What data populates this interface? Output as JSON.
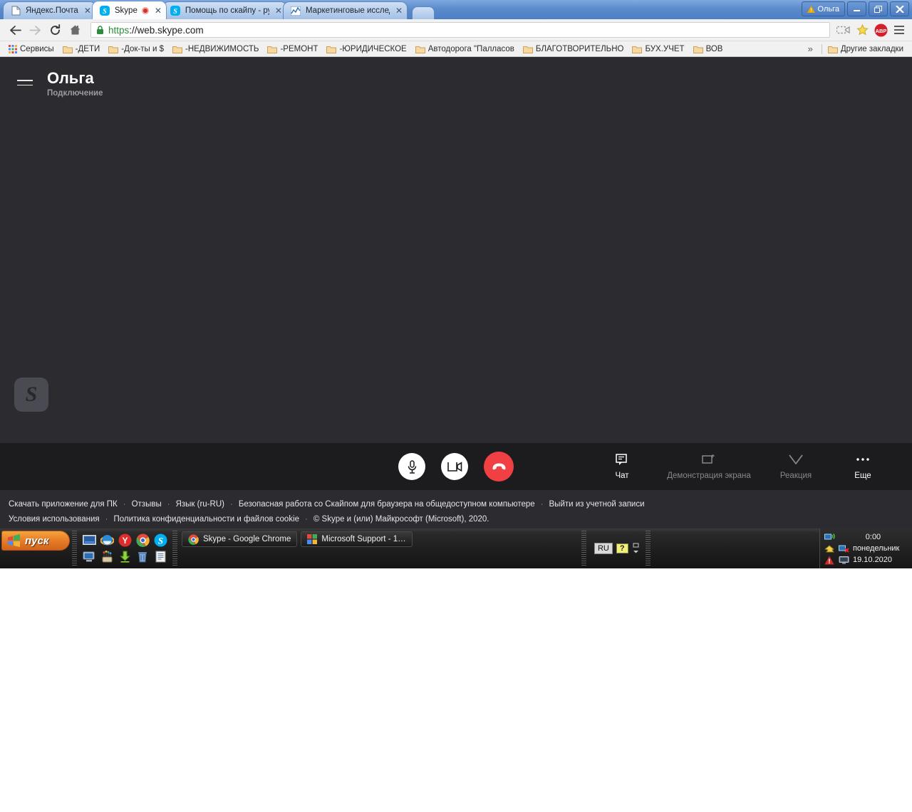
{
  "browser": {
    "tabs": [
      {
        "title": "Яндекс.Почта",
        "icon": "page-icon",
        "active": false,
        "recording": false
      },
      {
        "title": "Skype",
        "icon": "skype-icon",
        "active": true,
        "recording": true
      },
      {
        "title": "Помощь по скайпу - руков",
        "icon": "skype-icon",
        "active": false,
        "recording": false
      },
      {
        "title": "Маркетинговые исследова",
        "icon": "chart-icon",
        "active": false,
        "recording": false
      }
    ],
    "window": {
      "profile_label": "Ольга",
      "minimize": "—",
      "restore": "❐",
      "close": "✕"
    },
    "toolbar": {
      "back": "back-arrow",
      "forward": "forward-arrow",
      "reload": "reload-icon",
      "home": "home-icon",
      "url_scheme": "https",
      "url_rest": "://web.skype.com",
      "cast": "cast-icon",
      "bookmark_star": "star-icon",
      "extension": "ABP",
      "menu": "hamburger-menu"
    },
    "bookmarks": {
      "apps_label": "Сервисы",
      "items": [
        {
          "label": "-ДЕТИ"
        },
        {
          "label": "-Док-ты и $"
        },
        {
          "label": "-НЕДВИЖИМОСТЬ"
        },
        {
          "label": "-РЕМОНТ"
        },
        {
          "label": "-ЮРИДИЧЕСКОЕ"
        },
        {
          "label": "Автодорога \"Палласов"
        },
        {
          "label": "БЛАГОТВОРИТЕЛЬНО"
        },
        {
          "label": "БУХ.УЧЕТ"
        },
        {
          "label": "ВОВ"
        }
      ],
      "overflow": "»",
      "other_label": "Другие закладки"
    }
  },
  "skype": {
    "header": {
      "menu": "hamburger-menu",
      "name": "Ольга",
      "status": "Подключение"
    },
    "avatar_letter": "S",
    "call_controls": [
      {
        "name": "microphone",
        "style": "light"
      },
      {
        "name": "camera",
        "style": "light"
      },
      {
        "name": "end-call",
        "style": "hang"
      }
    ],
    "actions": [
      {
        "label": "Чат",
        "icon": "chat-icon",
        "enabled": true
      },
      {
        "label": "Демонстрация экрана",
        "icon": "screen-share-icon",
        "enabled": false
      },
      {
        "label": "Реакция",
        "icon": "reaction-icon",
        "enabled": false
      },
      {
        "label": "Еще",
        "icon": "more-icon",
        "enabled": true
      }
    ],
    "footer": {
      "row1": [
        {
          "text": "Скачать приложение для ПК",
          "link": true
        },
        {
          "text": "Отзывы",
          "link": true
        },
        {
          "text": "Язык (ru-RU)",
          "link": true
        },
        {
          "text": "Безопасная работа со Скайпом для браузера на общедоступном компьютере",
          "link": true
        },
        {
          "text": "Выйти из учетной записи",
          "link": true
        }
      ],
      "row2": [
        {
          "text": "Условия использования",
          "link": true
        },
        {
          "text": "Политика конфиденциальности и файлов cookie",
          "link": true
        },
        {
          "text": "© Skype и (или) Майкрософт (Microsoft), 2020.",
          "link": false
        }
      ],
      "separator": "·"
    }
  },
  "taskbar": {
    "start_label": "пуск",
    "quick_launch_row1": [
      "show-desktop-icon",
      "internet-explorer-icon",
      "yandex-browser-icon",
      "google-chrome-icon",
      "skype-icon"
    ],
    "quick_launch_row2": [
      "my-computer-icon",
      "paint-icon",
      "download-icon",
      "recycle-bin-icon",
      "notepad-icon"
    ],
    "language_indicator": "RU",
    "help_indicator": "?",
    "windows": [
      {
        "label": "Skype - Google Chrome",
        "icon": "google-chrome-icon",
        "active": true
      },
      {
        "label": "Microsoft Support - 1…",
        "icon": "microsoft-icon",
        "active": false
      }
    ],
    "tray": {
      "time": "0:00",
      "weekday": "понедельник",
      "date": "19.10.2020",
      "icons": [
        "network-icon",
        "update-icon",
        "network-error-icon",
        "warning-icon",
        "display-icon"
      ]
    }
  }
}
